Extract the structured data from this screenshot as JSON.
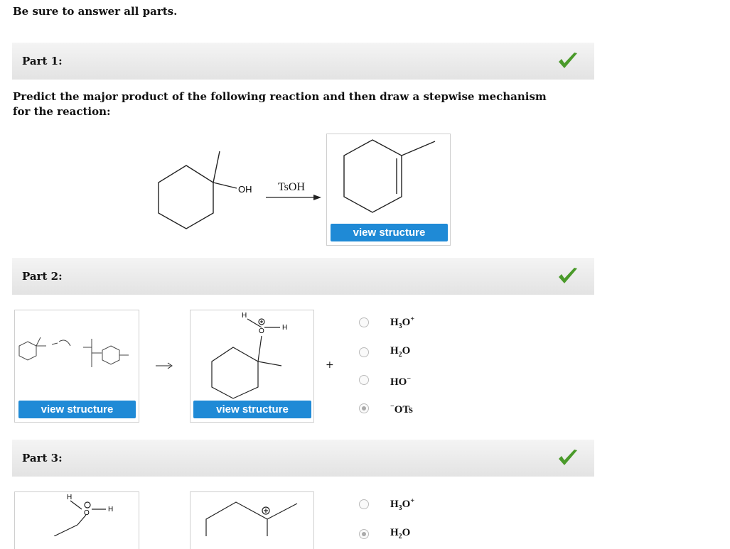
{
  "instruction": "Be sure to answer all parts.",
  "parts": [
    {
      "label": "Part 1:"
    },
    {
      "label": "Part 2:"
    },
    {
      "label": "Part 3:"
    }
  ],
  "question": "Predict the major product of the following reaction and then draw a stepwise mechanism for the reaction:",
  "reaction": {
    "oh_label": "OH",
    "reagent": "TsOH",
    "plus": "+"
  },
  "buttons": {
    "view_structure": "view structure"
  },
  "part2_options": [
    {
      "text": "H3O+",
      "selected": false
    },
    {
      "text": "H2O",
      "selected": false
    },
    {
      "text": "HO−",
      "selected": false
    },
    {
      "text": "−OTs",
      "selected": true
    }
  ],
  "part3_options": [
    {
      "text": "H3O+",
      "selected": false
    },
    {
      "text": "H2O",
      "selected": true
    }
  ],
  "atoms": {
    "h": "H",
    "o": "O"
  },
  "colors": {
    "check": "#4a9a2a",
    "button": "#1f8ad6"
  }
}
